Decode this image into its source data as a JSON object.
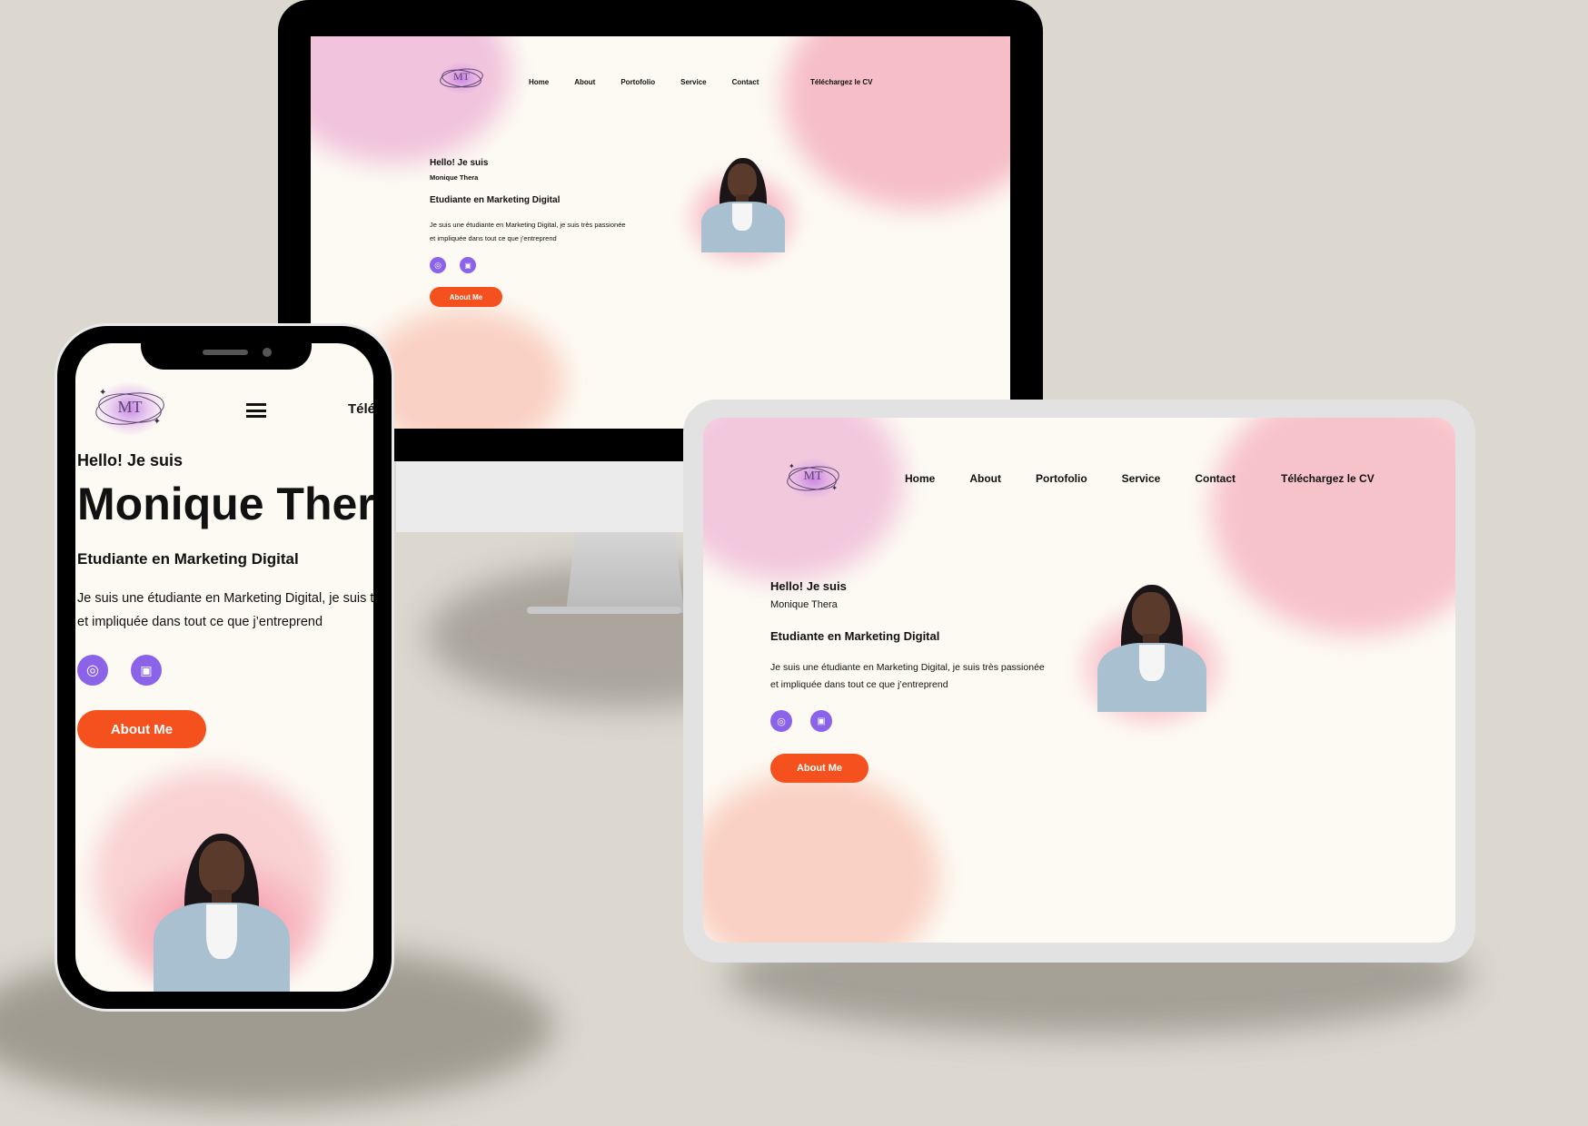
{
  "colors": {
    "background": "#dcd8cf",
    "site_bg": "#fdfaf3",
    "accent_purple": "#8a63e8",
    "cta_orange": "#f5511e",
    "blob_pink": "#f2a3b8"
  },
  "logo": {
    "text": "MT",
    "icon": "mt-monogram-logo"
  },
  "nav": {
    "items": [
      "Home",
      "About",
      "Portofolio",
      "Service",
      "Contact"
    ],
    "cv_link": "Téléchargez le CV",
    "cv_link_truncated": "Téléc",
    "menu_icon": "hamburger-menu-icon"
  },
  "hero": {
    "greeting": "Hello! Je suis",
    "name": "Monique Thera",
    "name_truncated": "Monique Thera",
    "role": "Etudiante en Marketing Digital",
    "bio_line1": "Je suis une étudiante en Marketing Digital, je suis très passionée",
    "bio_line2": "et impliquée dans tout ce que j’entreprend",
    "bio_line1_truncated": "Je suis une étudiante en Marketing Digital, je suis tr",
    "cta": "About Me",
    "social": [
      {
        "icon": "instagram-icon"
      },
      {
        "icon": "linkedin-icon"
      }
    ]
  }
}
